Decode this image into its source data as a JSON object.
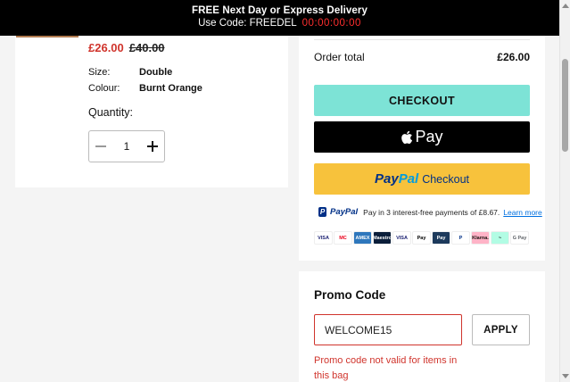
{
  "banner": {
    "headline": "FREE Next Day or Express Delivery",
    "code_text": "Use Code: FREEDEL",
    "countdown": "00:00:00:00"
  },
  "product": {
    "price_now": "£26.00",
    "price_was": "£40.00",
    "size_label": "Size:",
    "size_value": "Double",
    "colour_label": "Colour:",
    "colour_value": "Burnt Orange",
    "quantity_label": "Quantity:",
    "quantity_value": "1"
  },
  "summary": {
    "order_total_label": "Order total",
    "order_total_value": "£26.00",
    "checkout_label": "CHECKOUT",
    "apple_pay_label": "Pay",
    "paypal_pay": "Pay",
    "paypal_pal": "Pal",
    "paypal_checkout_label": "Checkout",
    "paylater_brand": "PayPal",
    "paylater_text": "Pay in 3 interest-free payments of £8.67.",
    "paylater_link": "Learn more"
  },
  "payment_methods": [
    {
      "name": "VISA",
      "color": "#1a1f71",
      "bg": "#ffffff"
    },
    {
      "name": "MC",
      "color": "#eb001b",
      "bg": "#ffffff"
    },
    {
      "name": "AMEX",
      "color": "#ffffff",
      "bg": "#2e77bc"
    },
    {
      "name": "Maestro",
      "color": "#ffffff",
      "bg": "#0b1e3a"
    },
    {
      "name": "VISA",
      "color": "#1a1f71",
      "bg": "#ffffff"
    },
    {
      "name": "Pay",
      "color": "#000000",
      "bg": "#ffffff"
    },
    {
      "name": "Pay",
      "color": "#ffffff",
      "bg": "#1d3a5c"
    },
    {
      "name": "P",
      "color": "#003087",
      "bg": "#ffffff"
    },
    {
      "name": "Klarna.",
      "color": "#17120f",
      "bg": "#ffb3c7"
    },
    {
      "name": "~",
      "color": "#000000",
      "bg": "#b2fce4"
    },
    {
      "name": "G Pay",
      "color": "#5f6368",
      "bg": "#ffffff"
    }
  ],
  "promo": {
    "title": "Promo Code",
    "input_value": "WELCOME15",
    "apply_label": "APPLY",
    "error": "Promo code not valid for items in this bag"
  },
  "colors": {
    "checkout_bg": "#7de3d6",
    "paypal_bg": "#f7c23c",
    "sale_red": "#d0342c"
  }
}
